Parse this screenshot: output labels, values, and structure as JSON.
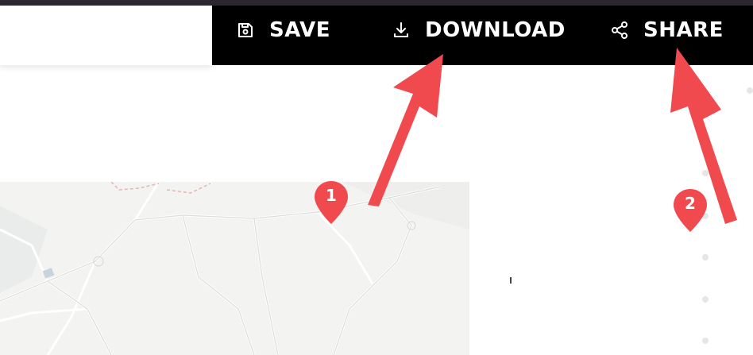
{
  "toolbar": {
    "save_label": "SAVE",
    "download_label": "DOWNLOAD",
    "share_label": "SHARE",
    "icons": {
      "save": "floppy-disk-icon",
      "download": "download-icon",
      "share": "share-icon"
    }
  },
  "annotations": [
    {
      "number": "1",
      "target": "download"
    },
    {
      "number": "2",
      "target": "share"
    }
  ],
  "colors": {
    "toolbar_bg": "#000000",
    "accent_red": "#f04a4f",
    "map_bg": "#f3f3f2"
  }
}
